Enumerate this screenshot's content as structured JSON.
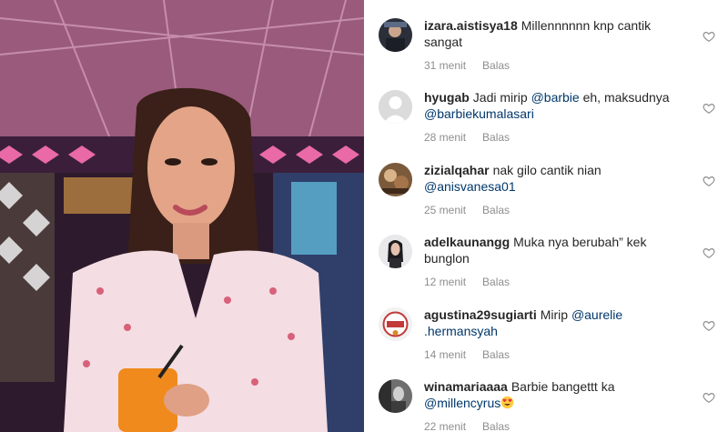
{
  "photo": {
    "alt": "woman-photo"
  },
  "comments": [
    {
      "username": "izara.aistisya18",
      "parts": [
        {
          "t": "text",
          "v": "Millennnnnn knp cantik sangat"
        }
      ],
      "time": "31 menit",
      "reply": "Balas",
      "avatar": "avatar-dark"
    },
    {
      "username": "hyugab",
      "parts": [
        {
          "t": "text",
          "v": "Jadi mirip "
        },
        {
          "t": "mention",
          "v": "@barbie"
        },
        {
          "t": "text",
          "v": " eh, maksudnya "
        },
        {
          "t": "mention",
          "v": "@barbiekumalasari"
        }
      ],
      "time": "28 menit",
      "reply": "Balas",
      "avatar": "default-avatar"
    },
    {
      "username": "zizialqahar",
      "parts": [
        {
          "t": "text",
          "v": "nak gilo cantik nian "
        },
        {
          "t": "mention",
          "v": "@anisvanesa01"
        }
      ],
      "time": "25 menit",
      "reply": "Balas",
      "avatar": "avatar-food"
    },
    {
      "username": "adelkaunangg",
      "parts": [
        {
          "t": "text",
          "v": "Muka nya berubah” kek bunglon"
        }
      ],
      "time": "12 menit",
      "reply": "Balas",
      "avatar": "avatar-person"
    },
    {
      "username": "agustina29sugiarti",
      "parts": [
        {
          "t": "text",
          "v": "Mirip "
        },
        {
          "t": "mention",
          "v": "@aurelie .hermansyah"
        }
      ],
      "time": "14 menit",
      "reply": "Balas",
      "avatar": "avatar-logo"
    },
    {
      "username": "winamariaaaa",
      "parts": [
        {
          "t": "text",
          "v": "Barbie bangettt ka "
        },
        {
          "t": "mention",
          "v": "@millencyrus"
        },
        {
          "t": "emoji",
          "v": "heart-eyes-emoji"
        }
      ],
      "time": "22 menit",
      "reply": "Balas",
      "avatar": "avatar-bw"
    }
  ],
  "colors": {
    "username": "#262626",
    "mention": "#00376b",
    "meta": "#8e8e8e",
    "heart": "#8e8e8e"
  }
}
